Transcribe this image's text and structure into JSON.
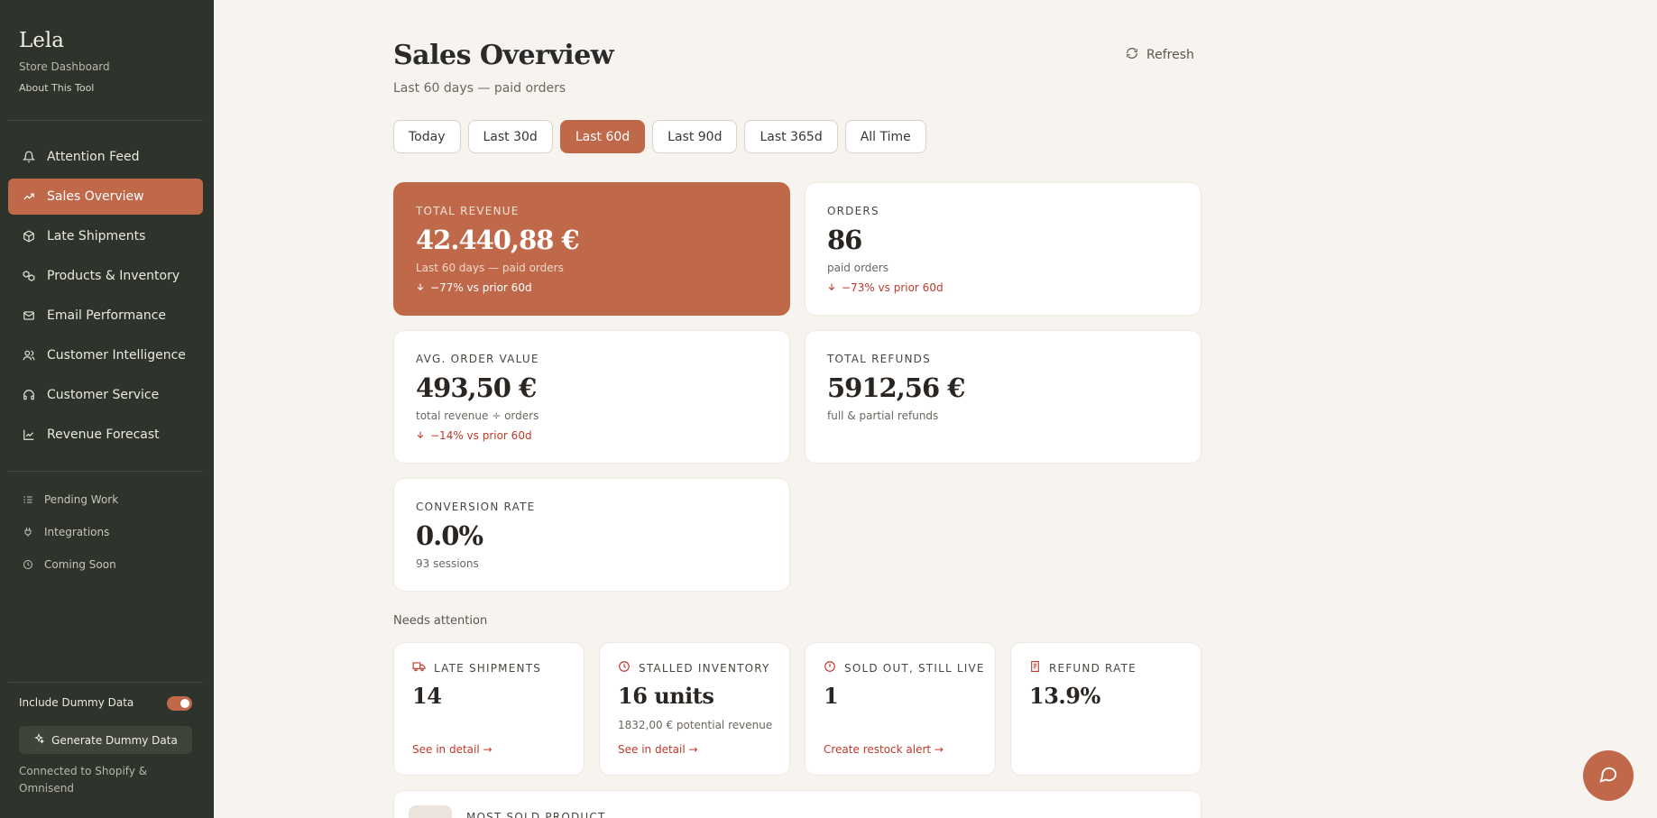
{
  "sidebar": {
    "brand": "Lela",
    "subtitle": "Store Dashboard",
    "about": "About This Tool",
    "nav": [
      {
        "label": "Attention Feed",
        "icon": "bell-icon"
      },
      {
        "label": "Sales Overview",
        "icon": "trending-up-icon",
        "active": true
      },
      {
        "label": "Late Shipments",
        "icon": "package-icon"
      },
      {
        "label": "Products & Inventory",
        "icon": "boxes-icon"
      },
      {
        "label": "Email Performance",
        "icon": "mail-icon"
      },
      {
        "label": "Customer Intelligence",
        "icon": "users-icon"
      },
      {
        "label": "Customer Service",
        "icon": "headset-icon"
      },
      {
        "label": "Revenue Forecast",
        "icon": "line-chart-icon"
      }
    ],
    "secondary": [
      {
        "label": "Pending Work",
        "icon": "list-checks-icon"
      },
      {
        "label": "Integrations",
        "icon": "plug-icon"
      },
      {
        "label": "Coming Soon",
        "icon": "clock-icon"
      }
    ],
    "dummy_toggle_label": "Include Dummy Data",
    "dummy_toggle_on": true,
    "generate_button": "Generate Dummy Data",
    "connected": "Connected to Shopify & Omnisend"
  },
  "header": {
    "title": "Sales Overview",
    "subtitle": "Last 60 days — paid orders",
    "refresh_label": "Refresh"
  },
  "ranges": [
    {
      "label": "Today"
    },
    {
      "label": "Last 30d"
    },
    {
      "label": "Last 60d",
      "active": true
    },
    {
      "label": "Last 90d"
    },
    {
      "label": "Last 365d"
    },
    {
      "label": "All Time"
    }
  ],
  "kpis": {
    "revenue": {
      "label": "TOTAL REVENUE",
      "value": "42.440,88 €",
      "desc": "Last 60 days — paid orders",
      "delta": "−77% vs prior 60d"
    },
    "orders": {
      "label": "ORDERS",
      "value": "86",
      "desc": "paid orders",
      "delta": "−73% vs prior 60d"
    },
    "aov": {
      "label": "AVG. ORDER VALUE",
      "value": "493,50 €",
      "desc": "total revenue ÷ orders",
      "delta": "−14% vs prior 60d"
    },
    "refunds": {
      "label": "TOTAL REFUNDS",
      "value": "5912,56 €",
      "desc": "full & partial refunds"
    },
    "conversion": {
      "label": "CONVERSION RATE",
      "value": "0.0%",
      "desc": "93 sessions"
    }
  },
  "attention": {
    "heading": "Needs attention",
    "cards": [
      {
        "label": "LATE SHIPMENTS",
        "icon": "truck-icon",
        "value": "14",
        "desc": "",
        "link": "See in detail →"
      },
      {
        "label": "STALLED INVENTORY",
        "icon": "clock-icon",
        "value": "16 units",
        "desc": "1832,00 € potential revenue",
        "link": "See in detail →"
      },
      {
        "label": "SOLD OUT, STILL LIVE",
        "icon": "alert-circle-icon",
        "value": "1",
        "desc": "",
        "link": "Create restock alert →"
      },
      {
        "label": "REFUND RATE",
        "icon": "receipt-icon",
        "value": "13.9%",
        "desc": "",
        "link": ""
      }
    ]
  },
  "bottom": {
    "label": "MOST SOLD PRODUCT"
  },
  "colors": {
    "accent": "#c0694a",
    "sidebar": "#2e342b",
    "background": "#f7f4ef",
    "negative": "#c0392b"
  }
}
